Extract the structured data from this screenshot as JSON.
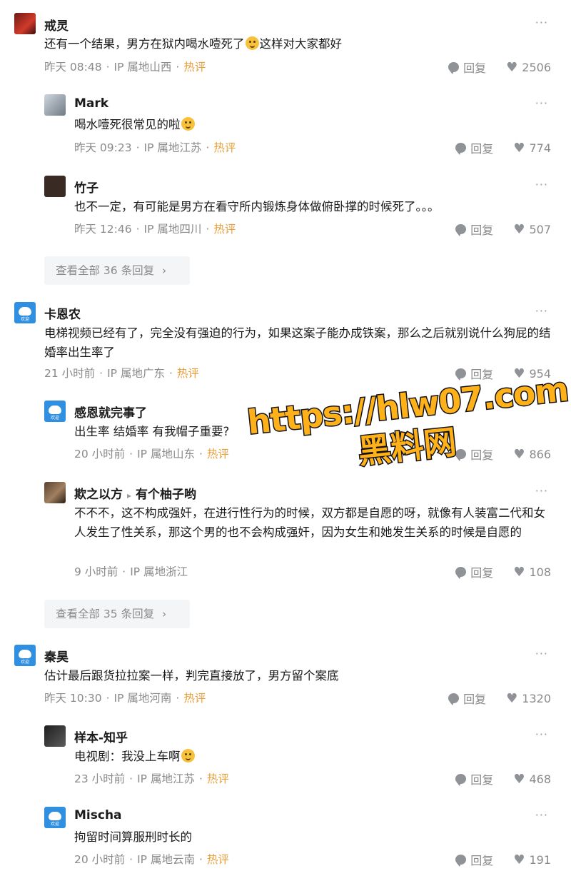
{
  "comments": [
    {
      "name": "戒灵",
      "text_before": "还有一个结果，男方在狱内喝水噎死了",
      "text_after": "这样对大家都好",
      "time": "昨天 08:48",
      "ip": "IP 属地山西",
      "hot": "热评",
      "reply": "回复",
      "likes": "2506"
    },
    {
      "name": "Mark",
      "text_before": "喝水噎死很常见的啦",
      "text_after": "",
      "time": "昨天 09:23",
      "ip": "IP 属地江苏",
      "hot": "热评",
      "reply": "回复",
      "likes": "774"
    },
    {
      "name": "竹子",
      "text": "也不一定，有可能是男方在看守所内锻炼身体做俯卧撑的时候死了。。。",
      "time": "昨天 12:46",
      "ip": "IP 属地四川",
      "hot": "热评",
      "reply": "回复",
      "likes": "507"
    },
    {
      "name": "卡恩农",
      "text": "电梯视频已经有了，完全没有强迫的行为，如果这案子能办成铁案，那么之后就别说什么狗屁的结婚率出生率了",
      "time": "21 小时前",
      "ip": "IP 属地广东",
      "hot": "热评",
      "reply": "回复",
      "likes": "954"
    },
    {
      "name": "感恩就完事了",
      "text": "出生率 结婚率 有我帽子重要?",
      "time": "20 小时前",
      "ip": "IP 属地山东",
      "hot": "热评",
      "reply": "回复",
      "likes": "866"
    },
    {
      "name": "欺之以方",
      "reply_to": "有个柚子哟",
      "text": "不不不，这不构成强奸，在进行性行为的时候，双方都是自愿的呀，就像有人装富二代和女人发生了性关系，那这个男的也不会构成强奸，因为女生和她发生关系的时候是自愿的",
      "time": "9 小时前",
      "ip": "IP 属地浙江",
      "reply": "回复",
      "likes": "108"
    },
    {
      "name": "秦昊",
      "text": "估计最后跟货拉拉案一样，判完直接放了，男方留个案底",
      "time": "昨天 10:30",
      "ip": "IP 属地河南",
      "hot": "热评",
      "reply": "回复",
      "likes": "1320"
    },
    {
      "name": "样本-知乎",
      "text_before": "电视剧：我没上车啊",
      "text_after": "",
      "time": "23 小时前",
      "ip": "IP 属地江苏",
      "hot": "热评",
      "reply": "回复",
      "likes": "468"
    },
    {
      "name": "Mischa",
      "text": "拘留时间算服刑时长的",
      "time": "20 小时前",
      "ip": "IP 属地云南",
      "hot": "热评",
      "reply": "回复",
      "likes": "191"
    }
  ],
  "view_all_1": "查看全部 36 条回复",
  "view_all_2": "查看全部 35 条回复",
  "more": "···",
  "arrow": "▸",
  "chevron": "›",
  "dot": "·",
  "watermark": {
    "url": "https://hlw07.com",
    "cn": "黑料网"
  },
  "avatar_caption": "欢迎"
}
